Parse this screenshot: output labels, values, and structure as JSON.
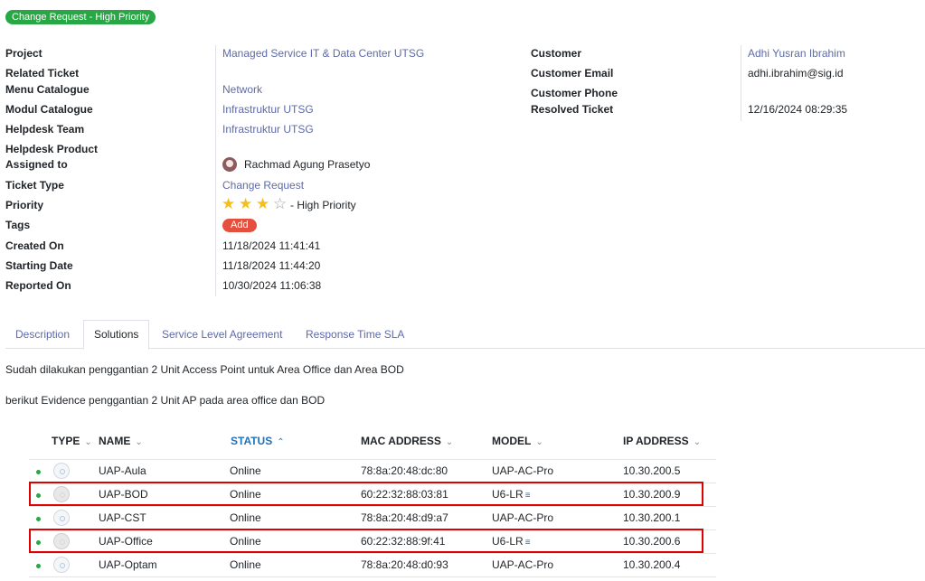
{
  "badge": "Change Request - High Priority",
  "details": {
    "project": {
      "label": "Project",
      "value": "Managed Service IT & Data Center UTSG"
    },
    "related_ticket": {
      "label": "Related Ticket",
      "value": ""
    },
    "menu_catalogue": {
      "label": "Menu Catalogue",
      "value": "Network"
    },
    "modul_catalogue": {
      "label": "Modul Catalogue",
      "value": "Infrastruktur UTSG"
    },
    "helpdesk_team": {
      "label": "Helpdesk Team",
      "value": "Infrastruktur UTSG"
    },
    "helpdesk_product": {
      "label": "Helpdesk Product",
      "value": ""
    },
    "assigned_to": {
      "label": "Assigned to",
      "value": "Rachmad Agung Prasetyo"
    },
    "ticket_type": {
      "label": "Ticket Type",
      "value": "Change Request"
    },
    "priority": {
      "label": "Priority",
      "value": "- High Priority",
      "stars": 3,
      "max_stars": 4
    },
    "tags": {
      "label": "Tags",
      "add_label": "Add"
    },
    "created_on": {
      "label": "Created On",
      "value": "11/18/2024 11:41:41"
    },
    "starting_date": {
      "label": "Starting Date",
      "value": "11/18/2024 11:44:20"
    },
    "reported_on": {
      "label": "Reported On",
      "value": "10/30/2024 11:06:38"
    },
    "customer": {
      "label": "Customer",
      "value": "Adhi Yusran Ibrahim"
    },
    "customer_email": {
      "label": "Customer Email",
      "value": "adhi.ibrahim@sig.id"
    },
    "customer_phone": {
      "label": "Customer Phone",
      "value": ""
    },
    "resolved_ticket": {
      "label": "Resolved Ticket",
      "value": "12/16/2024 08:29:35"
    }
  },
  "tabs": [
    {
      "label": "Description",
      "active": false
    },
    {
      "label": "Solutions",
      "active": true
    },
    {
      "label": "Service Level Agreement",
      "active": false
    },
    {
      "label": "Response Time SLA",
      "active": false
    }
  ],
  "solutions": {
    "line1": "Sudah dilakukan penggantian 2 Unit Access Point untuk Area Office dan Area BOD",
    "line2": "berikut Evidence penggantian 2 Unit AP pada area office dan BOD"
  },
  "table": {
    "headers": {
      "type": "TYPE",
      "name": "NAME",
      "status": "STATUS",
      "mac": "MAC ADDRESS",
      "model": "MODEL",
      "ip": "IP ADDRESS"
    },
    "sorted_column": "status",
    "rows": [
      {
        "name": "UAP-Aula",
        "status": "Online",
        "mac": "78:8a:20:48:dc:80",
        "model": "UAP-AC-Pro",
        "ip": "10.30.200.5",
        "highlighted": false
      },
      {
        "name": "UAP-BOD",
        "status": "Online",
        "mac": "60:22:32:88:03:81",
        "model": "U6-LR",
        "ip": "10.30.200.9",
        "highlighted": true
      },
      {
        "name": "UAP-CST",
        "status": "Online",
        "mac": "78:8a:20:48:d9:a7",
        "model": "UAP-AC-Pro",
        "ip": "10.30.200.1",
        "highlighted": false
      },
      {
        "name": "UAP-Office",
        "status": "Online",
        "mac": "60:22:32:88:9f:41",
        "model": "U6-LR",
        "ip": "10.30.200.6",
        "highlighted": true
      },
      {
        "name": "UAP-Optam",
        "status": "Online",
        "mac": "78:8a:20:48:d0:93",
        "model": "UAP-AC-Pro",
        "ip": "10.30.200.4",
        "highlighted": false
      }
    ]
  }
}
